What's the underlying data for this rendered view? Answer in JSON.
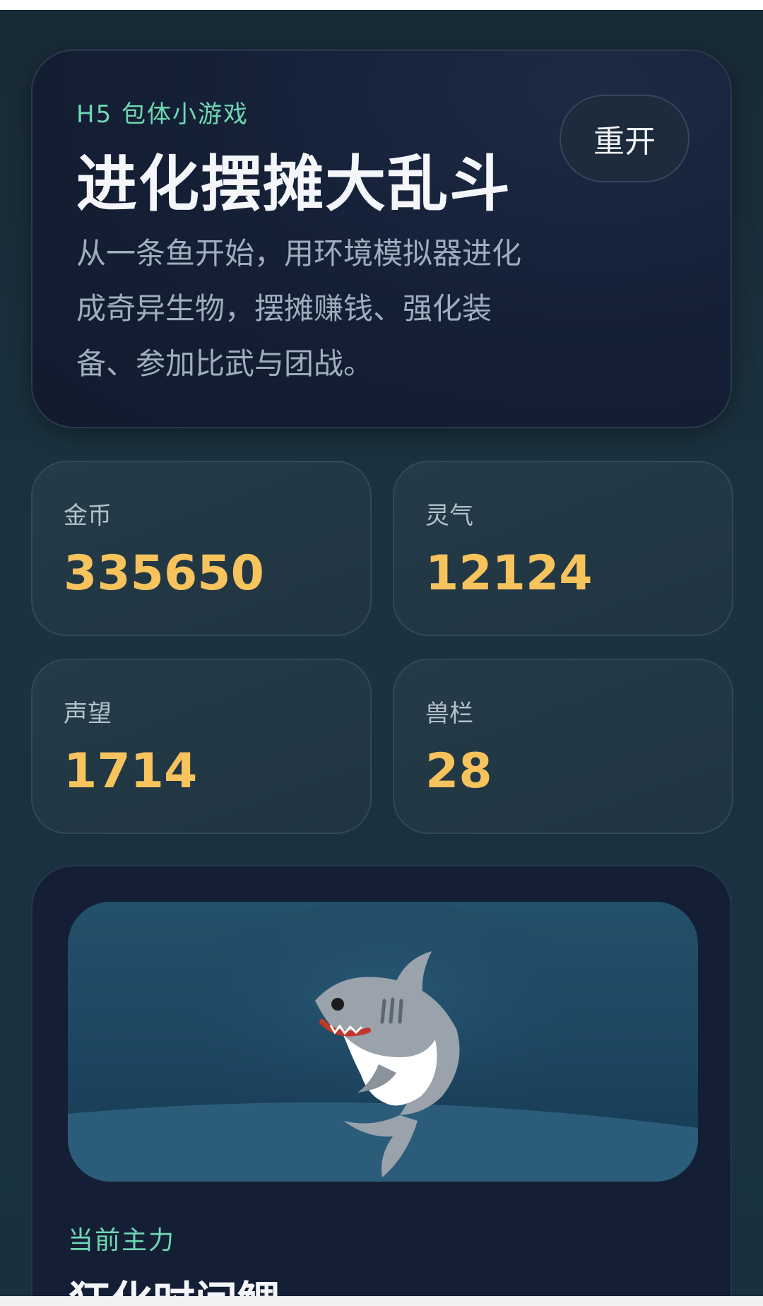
{
  "hero": {
    "kicker": "H5 包体小游戏",
    "title": "进化摆摊大乱斗",
    "description": "从一条鱼开始，用环境模拟器进化成奇异生物，摆摊赚钱、强化装备、参加比武与团战。",
    "restart_label": "重开"
  },
  "stats": [
    {
      "label": "金币",
      "value": "335650"
    },
    {
      "label": "灵气",
      "value": "12124"
    },
    {
      "label": "声望",
      "value": "1714"
    },
    {
      "label": "兽栏",
      "value": "28"
    }
  ],
  "main": {
    "creature_icon": "shark-icon",
    "subtitle": "当前主力",
    "current_name": "狂化时间鲷"
  },
  "colors": {
    "accent_green": "#6fd7b3",
    "value_gold": "#f7c35c",
    "panel_dark": "#141f35"
  }
}
